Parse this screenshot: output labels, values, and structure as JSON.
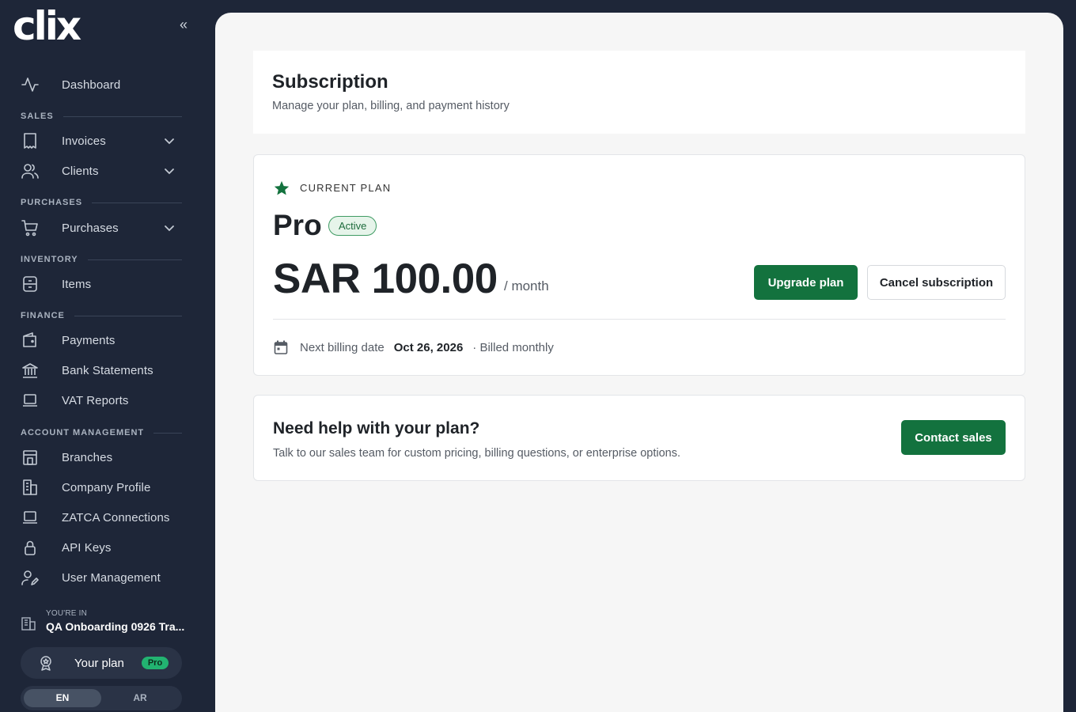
{
  "sidebar": {
    "brand": "clix",
    "collapse_glyph": "«",
    "nav": {
      "dashboard": {
        "label": "Dashboard",
        "icon": "activity-icon"
      },
      "sales_title": "SALES",
      "invoices": {
        "label": "Invoices",
        "icon": "receipt-icon"
      },
      "clients": {
        "label": "Clients",
        "icon": "users-icon"
      },
      "purchases_title": "PURCHASES",
      "purchases": {
        "label": "Purchases",
        "icon": "cart-icon"
      },
      "inventory_title": "INVENTORY",
      "items": {
        "label": "Items",
        "icon": "box-icon"
      },
      "finance_title": "FINANCE",
      "payments": {
        "label": "Payments",
        "icon": "wallet-icon"
      },
      "bank": {
        "label": "Bank Statements",
        "icon": "bank-icon"
      },
      "vat": {
        "label": "VAT Reports",
        "icon": "laptop-icon"
      },
      "account_title": "ACCOUNT MANAGEMENT",
      "branches": {
        "label": "Branches",
        "icon": "store-icon"
      },
      "company": {
        "label": "Company Profile",
        "icon": "building-icon"
      },
      "zatca": {
        "label": "ZATCA Connections",
        "icon": "laptop-icon"
      },
      "api": {
        "label": "API Keys",
        "icon": "lock-icon"
      },
      "users": {
        "label": "User Management",
        "icon": "user-edit-icon"
      }
    },
    "org": {
      "caption": "YOU'RE IN",
      "name": "QA Onboarding 0926 Tra..."
    },
    "plan": {
      "label": "Your plan",
      "badge": "Pro"
    },
    "lang": {
      "en": "EN",
      "ar": "AR",
      "selected": "EN"
    }
  },
  "header": {
    "title": "Subscription",
    "subtitle": "Manage your plan, billing, and payment history"
  },
  "plan_card": {
    "caption": "CURRENT PLAN",
    "plan_name": "Pro",
    "status": "Active",
    "price": "SAR 100.00",
    "period": "/ month",
    "upgrade_label": "Upgrade plan",
    "cancel_label": "Cancel subscription",
    "billing_label": "Next billing date",
    "billing_date": "Oct 26, 2026",
    "billing_cycle": "· Billed monthly"
  },
  "help_card": {
    "title": "Need help with your plan?",
    "subtitle": "Talk to our sales team for custom pricing, billing questions, or enterprise options.",
    "button_label": "Contact sales"
  },
  "colors": {
    "sidebar_bg": "#1e2638",
    "accent_green": "#13723e",
    "badge_green": "#22b371",
    "page_bg": "#f6f6f6"
  }
}
